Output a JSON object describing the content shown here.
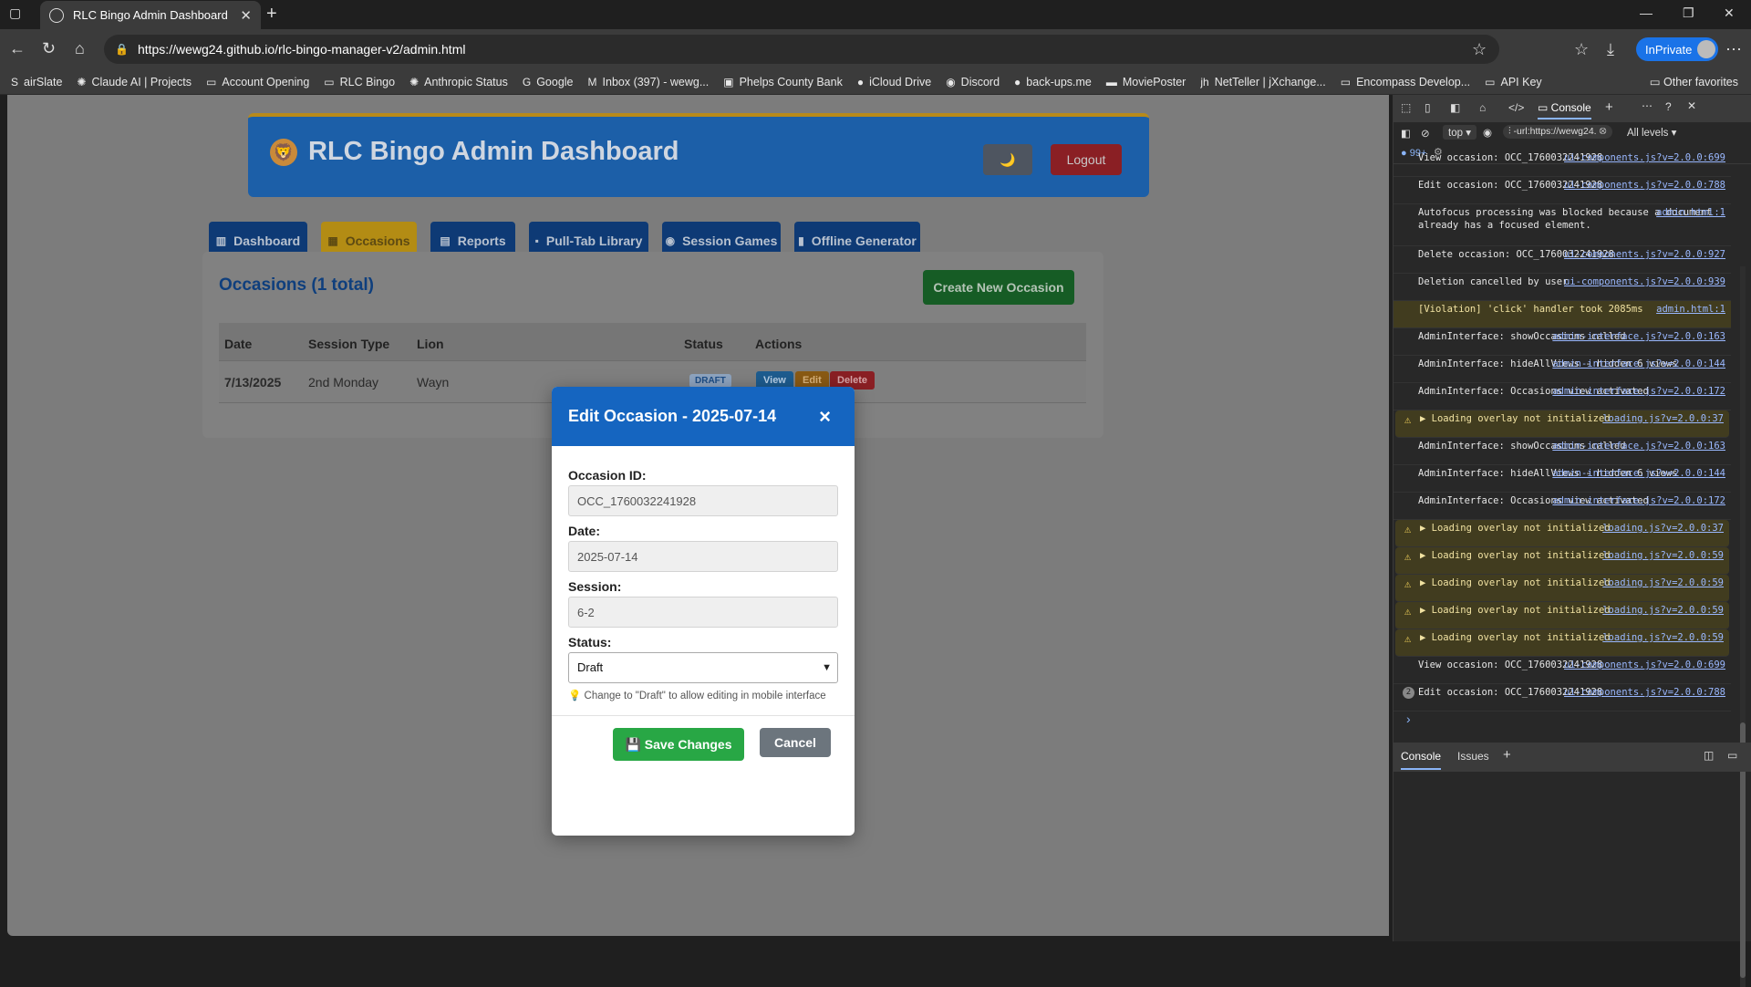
{
  "browser": {
    "tab_title": "RLC Bingo Admin Dashboard",
    "url": "https://wewg24.github.io/rlc-bingo-manager-v2/admin.html",
    "inprivate_label": "InPrivate",
    "favorites": [
      "airSlate",
      "Claude AI | Projects",
      "Account Opening",
      "RLC Bingo",
      "Anthropic Status",
      "Google",
      "Inbox (397) - wewg...",
      "Phelps County Bank",
      "iCloud Drive",
      "Discord",
      "back-ups.me",
      "MoviePoster",
      "NetTeller | jXchange...",
      "Encompass Develop...",
      "API Key"
    ],
    "other_favorites": "Other favorites"
  },
  "app": {
    "title": "RLC Bingo Admin Dashboard",
    "logo_icon": "lion-icon",
    "theme_toggle": "🌙",
    "logout": "Logout",
    "nav": [
      "Dashboard",
      "Occasions",
      "Reports",
      "Pull-Tab Library",
      "Session Games",
      "Offline Generator"
    ],
    "active_nav": "Occasions"
  },
  "occasions": {
    "heading": "Occasions (1 total)",
    "create_button": "Create New Occasion",
    "columns": [
      "Date",
      "Session Type",
      "Lion",
      "Status",
      "Actions"
    ],
    "rows": [
      {
        "date": "7/13/2025",
        "session_type": "2nd Monday",
        "lion": "Wayn",
        "status": "DRAFT",
        "actions": [
          "View",
          "Edit",
          "Delete"
        ]
      }
    ]
  },
  "modal": {
    "title": "Edit Occasion - 2025-07-14",
    "close": "×",
    "occasion_id_label": "Occasion ID:",
    "occasion_id_value": "OCC_1760032241928",
    "date_label": "Date:",
    "date_value": "2025-07-14",
    "session_label": "Session:",
    "session_value": "6-2",
    "status_label": "Status:",
    "status_value": "Draft",
    "hint": "Change to \"Draft\" to allow editing in mobile interface",
    "save": "Save Changes",
    "cancel": "Cancel"
  },
  "devtools": {
    "active_tab": "Console",
    "context": "top",
    "filter": "-url:https://wewg24.",
    "levels": "All levels",
    "issue_count": "99+",
    "bottom_tabs": [
      "Console",
      "Issues"
    ],
    "logs": [
      {
        "type": "info",
        "text": "View occasion: OCC_1760032241928",
        "src": "ui-components.js?v=2.0.0:699"
      },
      {
        "type": "info",
        "text": "Edit occasion: OCC_1760032241928",
        "src": "ui-components.js?v=2.0.0:788"
      },
      {
        "type": "info",
        "text": "Autofocus processing was blocked because a document already has a focused element.",
        "src": "admin.html:1"
      },
      {
        "type": "info",
        "text": "Delete occasion: OCC_1760032241928",
        "src": "ui-components.js?v=2.0.0:927"
      },
      {
        "type": "info",
        "text": "Deletion cancelled by user",
        "src": "ui-components.js?v=2.0.0:939"
      },
      {
        "type": "violation",
        "text": "[Violation] 'click' handler took 2085ms",
        "src": "admin.html:1"
      },
      {
        "type": "info",
        "text": "AdminInterface: showOccasions called",
        "src": "admin-interface.js?v=2.0.0:163"
      },
      {
        "type": "info",
        "text": "AdminInterface: hideAllViews - hidden 6 views",
        "src": "admin-interface.js?v=2.0.0:144"
      },
      {
        "type": "info",
        "text": "AdminInterface: Occasions view activated",
        "src": "admin-interface.js?v=2.0.0:172"
      },
      {
        "type": "warn",
        "text": "▶ Loading overlay not initialized",
        "src": "loading.js?v=2.0.0:37"
      },
      {
        "type": "info",
        "text": "AdminInterface: showOccasions called",
        "src": "admin-interface.js?v=2.0.0:163"
      },
      {
        "type": "info",
        "text": "AdminInterface: hideAllViews - hidden 6 views",
        "src": "admin-interface.js?v=2.0.0:144"
      },
      {
        "type": "info",
        "text": "AdminInterface: Occasions view activated",
        "src": "admin-interface.js?v=2.0.0:172"
      },
      {
        "type": "warn",
        "text": "▶ Loading overlay not initialized",
        "src": "loading.js?v=2.0.0:37"
      },
      {
        "type": "warn",
        "text": "▶ Loading overlay not initialized",
        "src": "loading.js?v=2.0.0:59"
      },
      {
        "type": "warn",
        "text": "▶ Loading overlay not initialized",
        "src": "loading.js?v=2.0.0:59"
      },
      {
        "type": "warn",
        "text": "▶ Loading overlay not initialized",
        "src": "loading.js?v=2.0.0:59"
      },
      {
        "type": "warn",
        "text": "▶ Loading overlay not initialized",
        "src": "loading.js?v=2.0.0:59"
      },
      {
        "type": "info",
        "text": "View occasion: OCC_1760032241928",
        "src": "ui-components.js?v=2.0.0:699"
      },
      {
        "type": "count",
        "text": "Edit occasion: OCC_1760032241928",
        "src": "ui-components.js?v=2.0.0:788",
        "count": "2"
      }
    ]
  }
}
